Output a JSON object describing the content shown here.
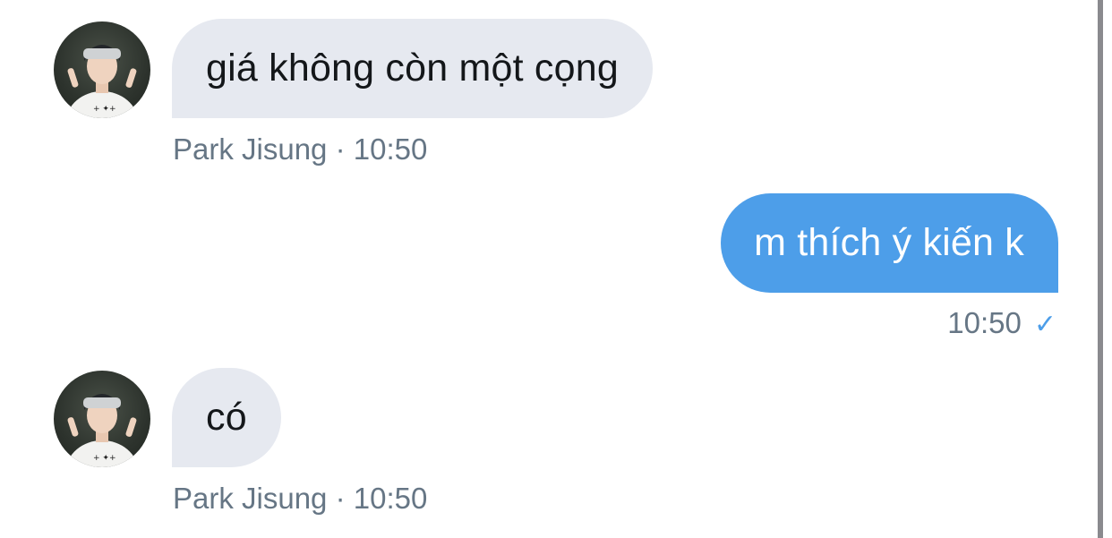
{
  "messages": [
    {
      "direction": "incoming",
      "text": "giá không còn một cọng",
      "sender": "Park Jisung",
      "separator": "·",
      "time": "10:50",
      "avatar": "user-avatar-photo"
    },
    {
      "direction": "outgoing",
      "text": "m thích ý kiến k",
      "time": "10:50",
      "status_icon": "checkmark-icon",
      "status_glyph": "✓"
    },
    {
      "direction": "incoming",
      "text": "có",
      "sender": "Park Jisung",
      "separator": "·",
      "time": "10:50",
      "avatar": "user-avatar-photo"
    }
  ],
  "colors": {
    "incoming_bubble": "#e6e9f0",
    "outgoing_bubble": "#4d9ee9",
    "meta_text": "#667685",
    "check": "#4d9ee9"
  }
}
